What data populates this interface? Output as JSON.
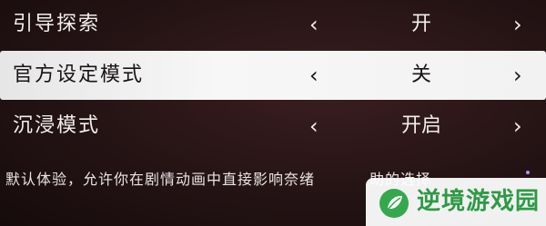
{
  "settings": [
    {
      "label": "引导探索",
      "value": "开"
    },
    {
      "label": "官方设定模式",
      "value": "关"
    },
    {
      "label": "沉浸模式",
      "value": "开启"
    }
  ],
  "controls": {
    "prev_symbol": "‹",
    "next_symbol": "›"
  },
  "description": "默认体验，允许你在剧情动画中直接影响奈绪",
  "description_tail": "助的选择",
  "watermark": {
    "text": "逆境游戏园",
    "logo": "leaf-circle-icon",
    "color": "#2e9a46"
  },
  "selected_index": 1
}
